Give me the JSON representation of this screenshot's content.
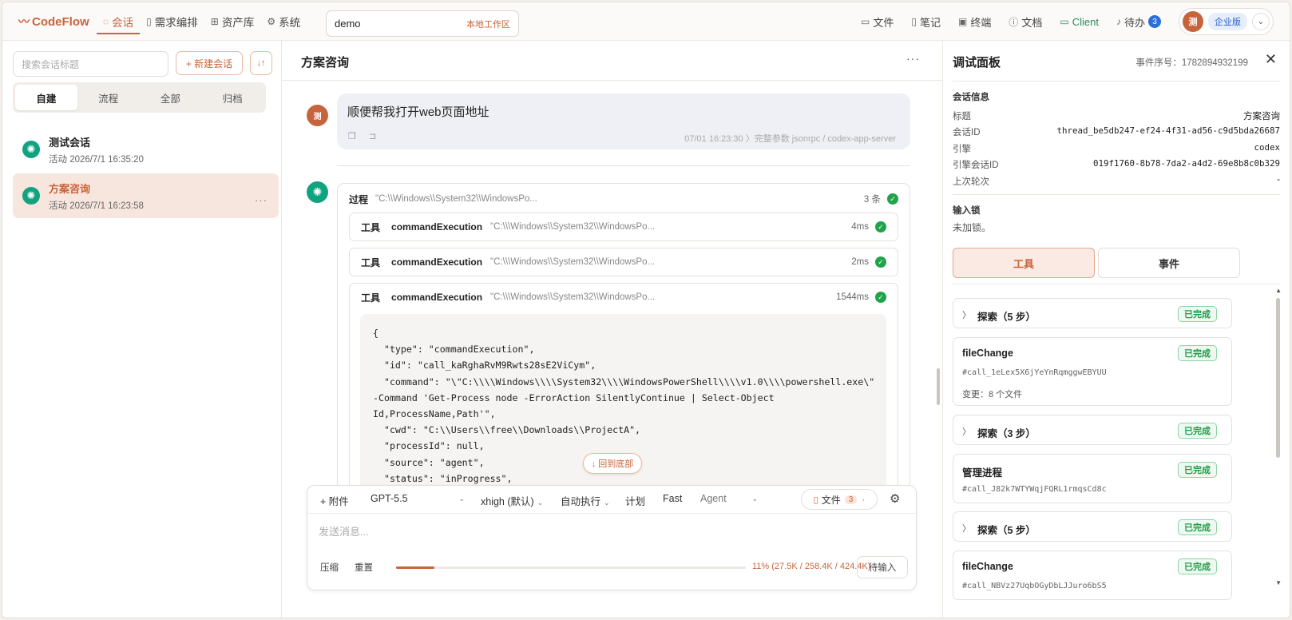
{
  "brand": {
    "name": "CodeFlow"
  },
  "nav": [
    {
      "label": "会话",
      "icon": "chat-icon"
    },
    {
      "label": "需求编排",
      "icon": "doc-icon"
    },
    {
      "label": "资产库",
      "icon": "assets-icon"
    },
    {
      "label": "系统",
      "icon": "gear-icon"
    }
  ],
  "workspace": {
    "value": "demo",
    "tag": "本地工作区"
  },
  "tools": [
    {
      "label": "文件",
      "icon": "folder-icon"
    },
    {
      "label": "笔记",
      "icon": "note-icon"
    },
    {
      "label": "终端",
      "icon": "terminal-icon"
    },
    {
      "label": "文档",
      "icon": "help-icon"
    },
    {
      "label": "Client",
      "icon": "monitor-icon"
    },
    {
      "label": "待办",
      "icon": "bell-icon"
    }
  ],
  "todo_count": "3",
  "user": {
    "avatar": "测",
    "edition": "企业版"
  },
  "sidebar": {
    "search_placeholder": "搜索会话标题",
    "new_label": "+ 新建会话",
    "tabs": [
      "自建",
      "流程",
      "全部",
      "归档"
    ],
    "conversations": [
      {
        "title": "测试会话",
        "time": "活动 2026/7/1 16:35:20"
      },
      {
        "title": "方案咨询",
        "time": "活动 2026/7/1 16:23:58"
      }
    ]
  },
  "main": {
    "title": "方案咨询",
    "user_msg": "顺便帮我打开web页面地址",
    "msg_meta": "07/01 16:23:30 〉完整参数 jsonrpc / codex-app-server",
    "process": {
      "label": "过程",
      "path": "\"C:\\\\Windows\\\\System32\\\\WindowsPo...",
      "count": "3 条"
    },
    "tools": [
      {
        "kind": "工具",
        "name": "commandExecution",
        "path": "\"C:\\\\\\Windows\\\\System32\\\\WindowsPo...",
        "ms": "4ms"
      },
      {
        "kind": "工具",
        "name": "commandExecution",
        "path": "\"C:\\\\\\Windows\\\\System32\\\\WindowsPo...",
        "ms": "2ms"
      },
      {
        "kind": "工具",
        "name": "commandExecution",
        "path": "\"C:\\\\\\Windows\\\\System32\\\\WindowsPo...",
        "ms": "1544ms"
      }
    ],
    "code": "{\n  \"type\": \"commandExecution\",\n  \"id\": \"call_kaRghaRvM9Rwts28sE2ViCym\",\n  \"command\": \"\\\"C:\\\\\\\\Windows\\\\\\\\System32\\\\\\\\WindowsPowerShell\\\\\\\\v1.0\\\\\\\\powershell.exe\\\"\n-Command 'Get-Process node -ErrorAction SilentlyContinue | Select-Object\nId,ProcessName,Path'\",\n  \"cwd\": \"C:\\\\Users\\\\free\\\\Downloads\\\\ProjectA\",\n  \"processId\": null,\n  \"source\": \"agent\",\n  \"status\": \"inProgress\",",
    "back_bottom": "↓ 回到底部"
  },
  "composer": {
    "attach": "+ 附件",
    "model": "GPT-5.5",
    "effort": "xhigh (默认)",
    "mode": "自动执行",
    "plan": "计划",
    "fast": "Fast",
    "agent": "Agent",
    "files": "文件",
    "files_count": "3",
    "placeholder": "发送消息...",
    "compress": "压缩",
    "reset": "重置",
    "usage_fraction": 0.11,
    "usage": "11% (27.5K / 258.4K / 424.4K)",
    "send": "待输入"
  },
  "debug": {
    "title": "调试面板",
    "event_seq": "事件序号：1782894932199",
    "info_title": "会话信息",
    "info": [
      {
        "k": "标题",
        "v": "方案咨询"
      },
      {
        "k": "会话ID",
        "v": "thread_be5db247-ef24-4f31-ad56-c9d5bda26687"
      },
      {
        "k": "引擎",
        "v": "codex"
      },
      {
        "k": "引擎会话ID",
        "v": "019f1760-8b78-7da2-a4d2-69e8b8c0b329"
      },
      {
        "k": "上次轮次",
        "v": "-"
      }
    ],
    "lock_title": "输入锁",
    "lock_value": "未加锁。",
    "tabs": [
      "工具",
      "事件"
    ],
    "cards": [
      {
        "title": "探索（5 步）",
        "status": "已完成"
      },
      {
        "title": "fileChange",
        "status": "已完成",
        "sub": "#call_1eLex5X6jYeYnRqmggwEBYUU",
        "change": "变更：8 个文件"
      },
      {
        "title": "探索（3 步）",
        "status": "已完成"
      },
      {
        "title": "管理进程",
        "status": "已完成",
        "sub": "#call_J82k7WTYWqjFQRL1rmqsCd8c"
      },
      {
        "title": "探索（5 步）",
        "status": "已完成"
      },
      {
        "title": "fileChange",
        "status": "已完成",
        "sub": "#call_NBVz27UqbOGyDbLJJuro6bS5"
      }
    ]
  },
  "colors": {
    "accent": "#c8643c",
    "success": "#20a34a",
    "gpt": "#10a37f"
  }
}
